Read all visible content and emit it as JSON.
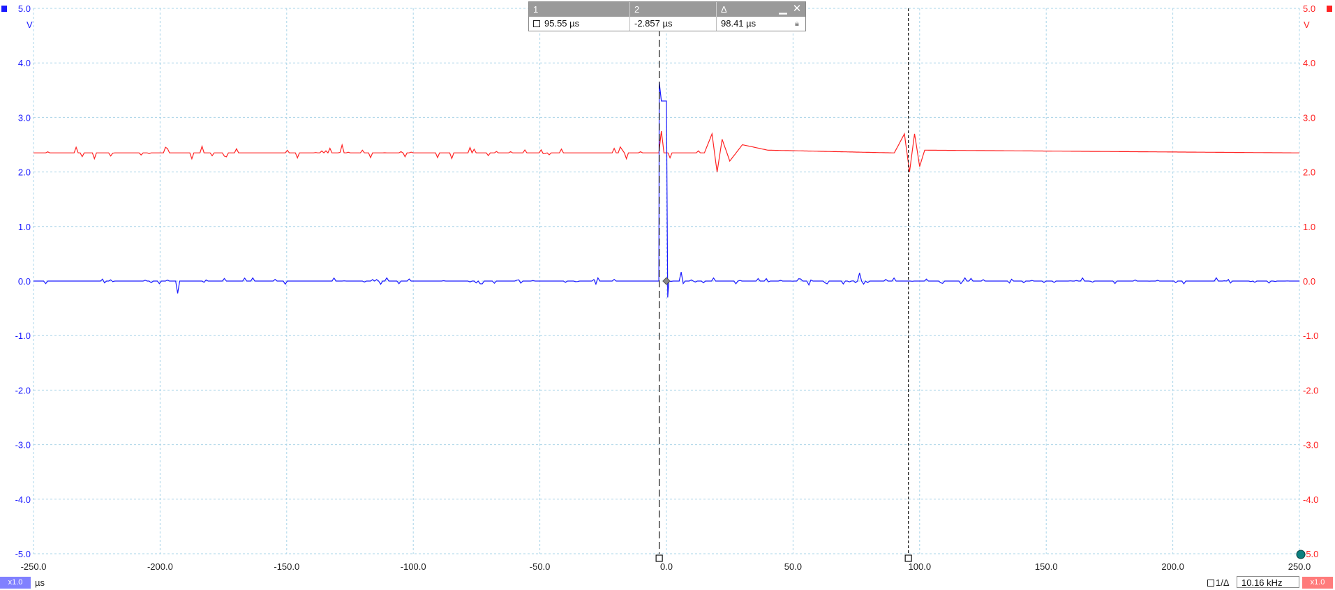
{
  "channel1": {
    "color": "#1a1aff",
    "unit": "V",
    "scale_badge": "x1.0",
    "y_ticks": [
      "5.0",
      "4.0",
      "3.0",
      "2.0",
      "1.0",
      "0.0",
      "-1.0",
      "-2.0",
      "-3.0",
      "-4.0",
      "-5.0"
    ]
  },
  "channel2": {
    "color": "#ff2222",
    "unit": "V",
    "scale_badge": "x1.0",
    "y_ticks": [
      "5.0",
      "4.0",
      "3.0",
      "2.0",
      "1.0",
      "0.0",
      "-1.0",
      "-2.0",
      "-3.0",
      "-4.0",
      "-5.0"
    ]
  },
  "time_axis": {
    "unit": "µs",
    "ticks": [
      "-250.0",
      "-200.0",
      "-150.0",
      "-100.0",
      "-50.0",
      "0.0",
      "50.0",
      "100.0",
      "150.0",
      "200.0",
      "250.0"
    ]
  },
  "cursor_panel": {
    "col1_header": "1",
    "col2_header": "2",
    "col3_header": "Δ",
    "col1_value": "95.55 µs",
    "col2_value": "-2.857 µs",
    "col3_value": "98.41 µs"
  },
  "frequency": {
    "label": "1/Δ",
    "value": "10.16 kHz"
  },
  "chart_data": {
    "type": "line",
    "x_range": [
      -250,
      250
    ],
    "y_range": [
      -5,
      5
    ],
    "x_unit": "µs",
    "y_unit": "V",
    "grid": true,
    "cursors": [
      {
        "name": "1",
        "x": 95.55
      },
      {
        "name": "2",
        "x": -2.857
      }
    ],
    "series": [
      {
        "color": "#ff2222",
        "baseline": 2.35,
        "points": [
          [
            -250,
            2.35
          ],
          [
            -3,
            2.35
          ],
          [
            -2,
            2.75
          ],
          [
            -1,
            2.35
          ],
          [
            15,
            2.35
          ],
          [
            18,
            2.7
          ],
          [
            20,
            2.0
          ],
          [
            22,
            2.6
          ],
          [
            25,
            2.2
          ],
          [
            30,
            2.5
          ],
          [
            40,
            2.4
          ],
          [
            90,
            2.35
          ],
          [
            94,
            2.7
          ],
          [
            96,
            2.0
          ],
          [
            98,
            2.7
          ],
          [
            100,
            2.1
          ],
          [
            102,
            2.4
          ],
          [
            250,
            2.35
          ]
        ]
      },
      {
        "color": "#1a1aff",
        "baseline": 0.0,
        "points": [
          [
            -250,
            0.0
          ],
          [
            -3,
            0.0
          ],
          [
            -2.857,
            3.65
          ],
          [
            -2,
            3.3
          ],
          [
            0,
            3.3
          ],
          [
            0.5,
            -0.3
          ],
          [
            1,
            0.0
          ],
          [
            250,
            0.0
          ]
        ]
      }
    ]
  }
}
